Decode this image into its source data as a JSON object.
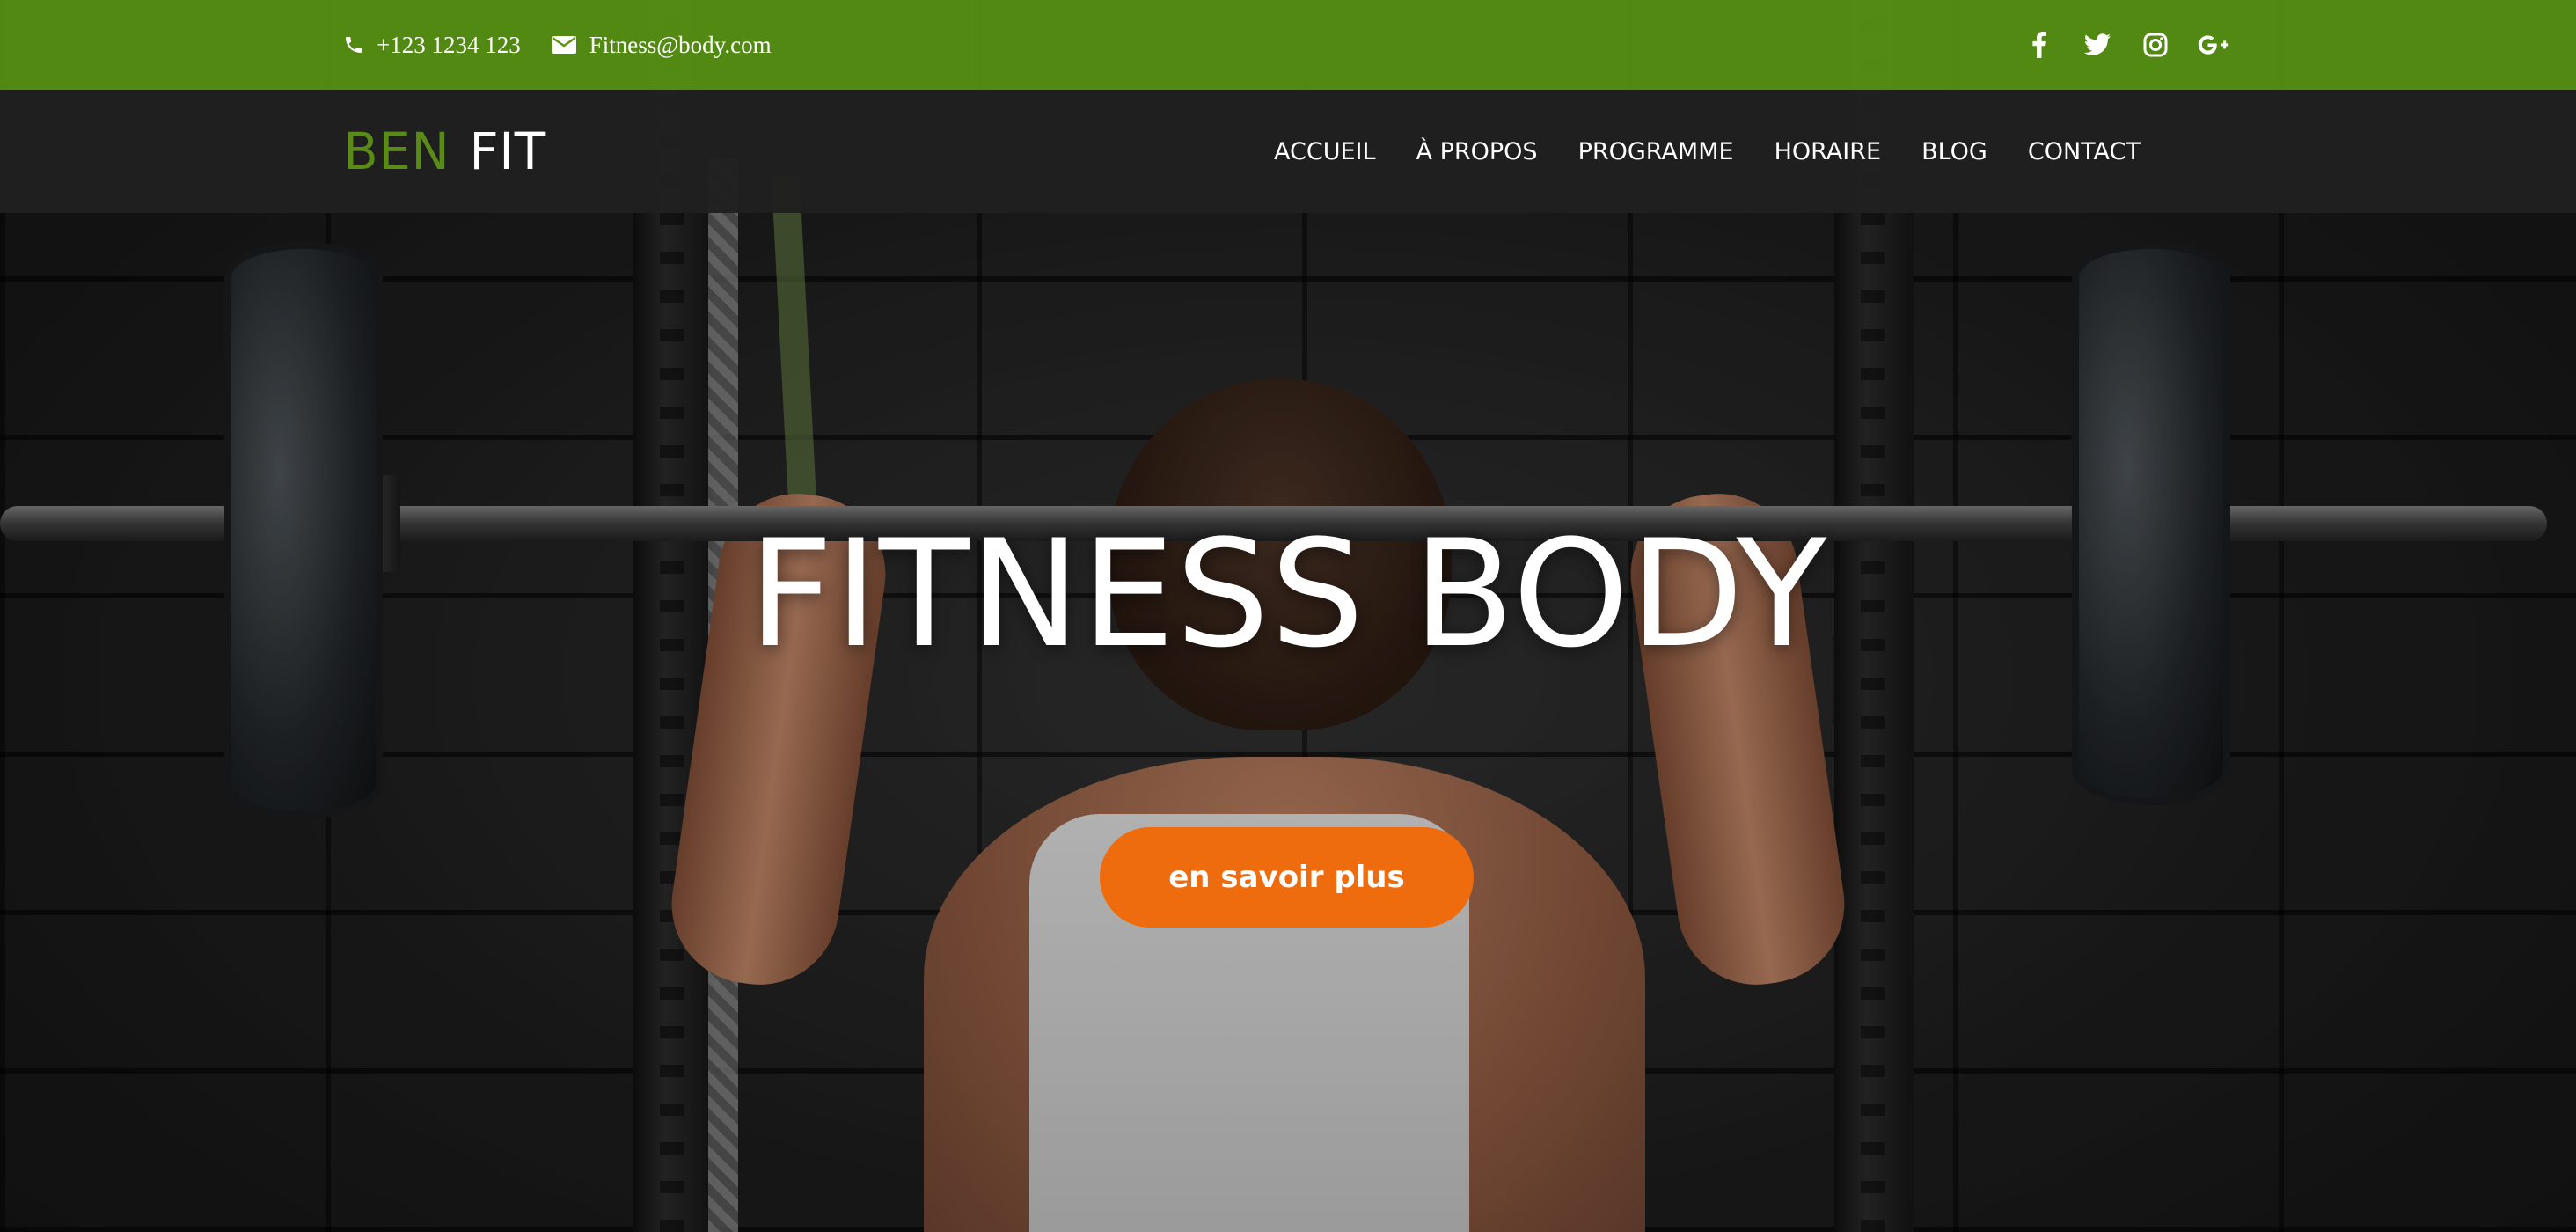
{
  "topbar": {
    "phone": "+123 1234 123",
    "email": "Fitness@body.com",
    "social": [
      "facebook-icon",
      "twitter-icon",
      "instagram-icon",
      "google-plus-icon"
    ],
    "background_color": "#579414"
  },
  "nav": {
    "logo_part1": "BEN",
    "logo_part2": "FIT",
    "logo_accent_color": "#5a8a18",
    "items": [
      {
        "label": "ACCUEIL"
      },
      {
        "label": "À PROPOS"
      },
      {
        "label": "PROGRAMME"
      },
      {
        "label": "HORAIRE"
      },
      {
        "label": "BLOG"
      },
      {
        "label": "CONTACT"
      }
    ]
  },
  "hero": {
    "title": "FITNESS BODY",
    "cta_label": "en savoir plus",
    "cta_color": "#ef6c0e"
  }
}
